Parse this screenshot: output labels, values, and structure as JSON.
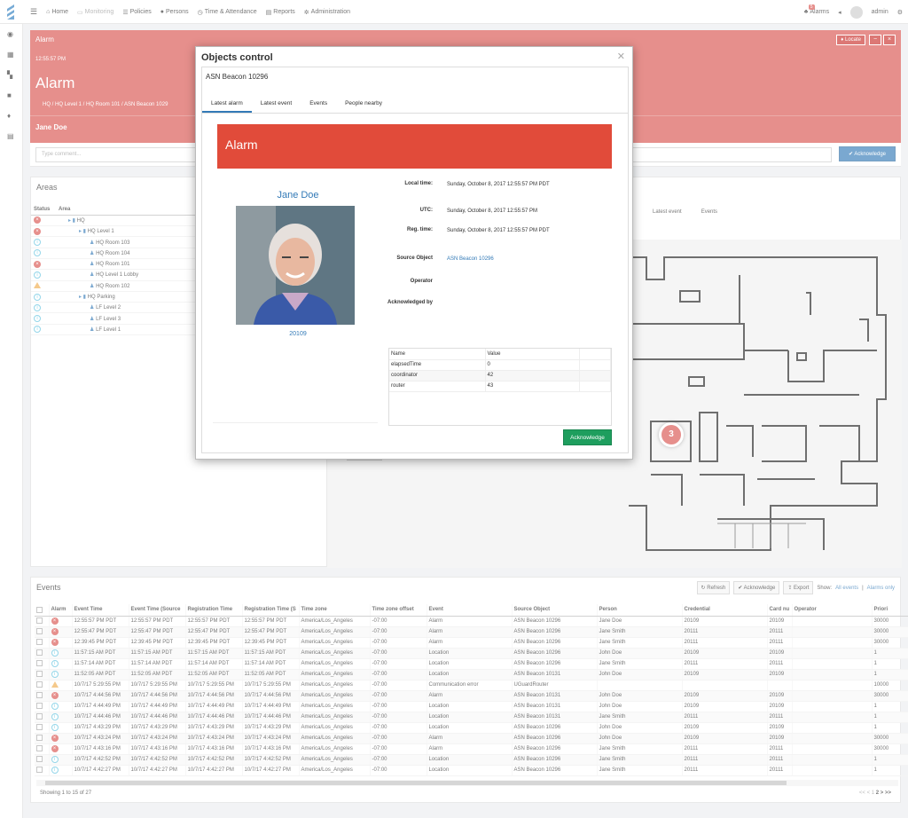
{
  "nav": {
    "home": "Home",
    "monitoring": "Monitoring",
    "policies": "Policies",
    "persons": "Persons",
    "time_attendance": "Time & Attendance",
    "reports": "Reports",
    "administration": "Administration",
    "alarms": "Alarms",
    "alarms_count": "5",
    "user": "admin"
  },
  "alarm_panel": {
    "label": "Alarm",
    "time": "12:55:57 PM",
    "title": "Alarm",
    "breadcrumb": "HQ / HQ Level 1 / HQ Room 101 / ASN Beacon 1029",
    "person": "Jane Doe",
    "locate": "Locate",
    "comment_placeholder": "Type comment...",
    "acknowledge": "Acknowledge"
  },
  "areas": {
    "title": "Areas",
    "col_status": "Status",
    "col_area": "Area",
    "rows": [
      {
        "status": "error",
        "name": "HQ",
        "indent": 1,
        "type": "folder"
      },
      {
        "status": "error",
        "name": "HQ Level 1",
        "indent": 2,
        "type": "folder"
      },
      {
        "status": "info",
        "name": "HQ Room 103",
        "indent": 3,
        "type": "group"
      },
      {
        "status": "info",
        "name": "HQ Room 104",
        "indent": 3,
        "type": "group"
      },
      {
        "status": "error",
        "name": "HQ Room 101",
        "indent": 3,
        "type": "group"
      },
      {
        "status": "info",
        "name": "HQ Level 1 Lobby",
        "indent": 3,
        "type": "group"
      },
      {
        "status": "warning",
        "name": "HQ Room 102",
        "indent": 3,
        "type": "group"
      },
      {
        "status": "info",
        "name": "HQ Parking",
        "indent": 2,
        "type": "folder"
      },
      {
        "status": "info",
        "name": "LF Level 2",
        "indent": 3,
        "type": "group"
      },
      {
        "status": "info",
        "name": "LF Level 3",
        "indent": 3,
        "type": "group"
      },
      {
        "status": "info",
        "name": "LF Level 1",
        "indent": 3,
        "type": "group"
      }
    ]
  },
  "map": {
    "tab1": "m",
    "tab2": "Latest event",
    "tab3": "Events",
    "marker_count": "3"
  },
  "events": {
    "title": "Events",
    "refresh": "Refresh",
    "acknowledge": "Acknowledge",
    "export": "Export",
    "show": "Show:",
    "all_events": "All events",
    "alarms_only": "Alarms only",
    "footer": "Showing 1 to 15 of 27",
    "pager": {
      "first": "<<",
      "prev": "<",
      "page1": "1",
      "page2": "2",
      "next": ">",
      "last": ">>"
    },
    "columns": [
      "Alarm",
      "Event Time",
      "Event Time (Source",
      "Registration Time",
      "Registration Time (S",
      "Time zone",
      "Time zone offset",
      "Event",
      "Source Object",
      "Person",
      "Credential",
      "Card nu",
      "Operator",
      "Priori"
    ],
    "rows": [
      [
        "error",
        "12:55:57 PM PDT",
        "12:55:57 PM PDT",
        "12:55:57 PM PDT",
        "12:55:57 PM PDT",
        "America/Los_Angeles",
        "-07:00",
        "Alarm",
        "ASN Beacon 10296",
        "Jane Doe",
        "20109",
        "20109",
        "",
        "30000"
      ],
      [
        "error",
        "12:55:47 PM PDT",
        "12:55:47 PM PDT",
        "12:55:47 PM PDT",
        "12:55:47 PM PDT",
        "America/Los_Angeles",
        "-07:00",
        "Alarm",
        "ASN Beacon 10296",
        "Jane Smith",
        "20111",
        "20111",
        "",
        "30000"
      ],
      [
        "error",
        "12:39:45 PM PDT",
        "12:39:45 PM PDT",
        "12:39:45 PM PDT",
        "12:39:45 PM PDT",
        "America/Los_Angeles",
        "-07:00",
        "Alarm",
        "ASN Beacon 10296",
        "Jane Smith",
        "20111",
        "20111",
        "",
        "30000"
      ],
      [
        "info",
        "11:57:15 AM PDT",
        "11:57:15 AM PDT",
        "11:57:15 AM PDT",
        "11:57:15 AM PDT",
        "America/Los_Angeles",
        "-07:00",
        "Location",
        "ASN Beacon 10296",
        "John Doe",
        "20109",
        "20109",
        "",
        "1"
      ],
      [
        "info",
        "11:57:14 AM PDT",
        "11:57:14 AM PDT",
        "11:57:14 AM PDT",
        "11:57:14 AM PDT",
        "America/Los_Angeles",
        "-07:00",
        "Location",
        "ASN Beacon 10296",
        "Jane Smith",
        "20111",
        "20111",
        "",
        "1"
      ],
      [
        "info",
        "11:52:05 AM PDT",
        "11:52:05 AM PDT",
        "11:52:05 AM PDT",
        "11:52:05 AM PDT",
        "America/Los_Angeles",
        "-07:00",
        "Location",
        "ASN Beacon 10131",
        "John Doe",
        "20109",
        "20109",
        "",
        "1"
      ],
      [
        "warning",
        "10/7/17 5:29:55 PM",
        "10/7/17 5:29:55 PM",
        "10/7/17 5:29:55 PM",
        "10/7/17 5:29:55 PM",
        "America/Los_Angeles",
        "-07:00",
        "Communication error",
        "UGuardRouter",
        "",
        "",
        "",
        "",
        "10000"
      ],
      [
        "error",
        "10/7/17 4:44:56 PM",
        "10/7/17 4:44:56 PM",
        "10/7/17 4:44:56 PM",
        "10/7/17 4:44:56 PM",
        "America/Los_Angeles",
        "-07:00",
        "Alarm",
        "ASN Beacon 10131",
        "John Doe",
        "20109",
        "20109",
        "",
        "30000"
      ],
      [
        "info",
        "10/7/17 4:44:49 PM",
        "10/7/17 4:44:49 PM",
        "10/7/17 4:44:49 PM",
        "10/7/17 4:44:49 PM",
        "America/Los_Angeles",
        "-07:00",
        "Location",
        "ASN Beacon 10131",
        "John Doe",
        "20109",
        "20109",
        "",
        "1"
      ],
      [
        "info",
        "10/7/17 4:44:46 PM",
        "10/7/17 4:44:46 PM",
        "10/7/17 4:44:46 PM",
        "10/7/17 4:44:46 PM",
        "America/Los_Angeles",
        "-07:00",
        "Location",
        "ASN Beacon 10131",
        "Jane Smith",
        "20111",
        "20111",
        "",
        "1"
      ],
      [
        "info",
        "10/7/17 4:43:29 PM",
        "10/7/17 4:43:29 PM",
        "10/7/17 4:43:29 PM",
        "10/7/17 4:43:29 PM",
        "America/Los_Angeles",
        "-07:00",
        "Location",
        "ASN Beacon 10296",
        "John Doe",
        "20109",
        "20109",
        "",
        "1"
      ],
      [
        "error",
        "10/7/17 4:43:24 PM",
        "10/7/17 4:43:24 PM",
        "10/7/17 4:43:24 PM",
        "10/7/17 4:43:24 PM",
        "America/Los_Angeles",
        "-07:00",
        "Alarm",
        "ASN Beacon 10296",
        "John Doe",
        "20109",
        "20109",
        "",
        "30000"
      ],
      [
        "error",
        "10/7/17 4:43:16 PM",
        "10/7/17 4:43:16 PM",
        "10/7/17 4:43:16 PM",
        "10/7/17 4:43:16 PM",
        "America/Los_Angeles",
        "-07:00",
        "Alarm",
        "ASN Beacon 10296",
        "Jane Smith",
        "20111",
        "20111",
        "",
        "30000"
      ],
      [
        "info",
        "10/7/17 4:42:52 PM",
        "10/7/17 4:42:52 PM",
        "10/7/17 4:42:52 PM",
        "10/7/17 4:42:52 PM",
        "America/Los_Angeles",
        "-07:00",
        "Location",
        "ASN Beacon 10296",
        "Jane Smith",
        "20111",
        "20111",
        "",
        "1"
      ],
      [
        "info",
        "10/7/17 4:42:27 PM",
        "10/7/17 4:42:27 PM",
        "10/7/17 4:42:27 PM",
        "10/7/17 4:42:27 PM",
        "America/Los_Angeles",
        "-07:00",
        "Location",
        "ASN Beacon 10296",
        "Jane Smith",
        "20111",
        "20111",
        "",
        "1"
      ]
    ]
  },
  "modal": {
    "title": "Objects control",
    "object": "ASN Beacon 10296",
    "tabs": [
      "Latest alarm",
      "Latest event",
      "Events",
      "People nearby"
    ],
    "banner": "Alarm",
    "person_name": "Jane Doe",
    "person_id": "20109",
    "fields": [
      {
        "label": "Local time:",
        "value": "Sunday, October 8, 2017 12:55:57 PM PDT"
      },
      {
        "label": "UTC:",
        "value": "Sunday, October 8, 2017 12:55:57 PM"
      },
      {
        "label": "Reg. time:",
        "value": "Sunday, October 8, 2017 12:55:57 PM PDT"
      },
      {
        "label": "Source Object",
        "value": "ASN Beacon 10296"
      },
      {
        "label": "Operator",
        "value": ""
      },
      {
        "label": "Acknowledged by",
        "value": ""
      }
    ],
    "prop_cols": [
      "Name",
      "Value"
    ],
    "props": [
      [
        "elapsedTime",
        "0"
      ],
      [
        "coordinator",
        "42"
      ],
      [
        "router",
        "43"
      ]
    ],
    "acknowledge": "Acknowledge"
  },
  "colors": {
    "alarm_red": "#d9534f",
    "banner_red": "#e14b3a",
    "primary": "#337ab7",
    "success": "#1e9e5e",
    "info": "#5bc0de",
    "warning": "#f0ad4e"
  }
}
